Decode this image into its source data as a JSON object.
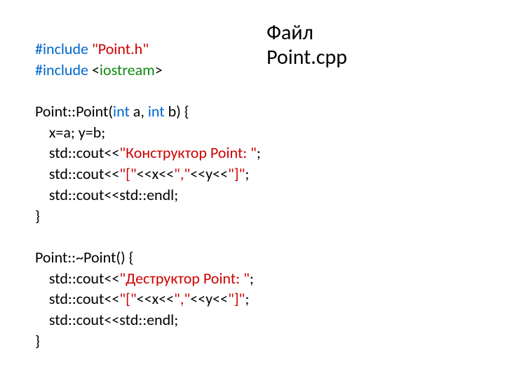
{
  "title": {
    "line1": "Файл",
    "line2": "Point.cpp"
  },
  "code": {
    "include_kw1": "#include",
    "include_hdr": " \"Point.h\"",
    "include_kw2": "#include",
    "include_io_open": " <",
    "include_io_name": "iostream",
    "include_io_close": ">",
    "ctor_sig_a": "Point::Point(",
    "int1": "int",
    "ctor_sig_b": " a, ",
    "int2": "int",
    "ctor_sig_c": " b) {",
    "assign": "    x=a; y=b;",
    "ctor_cout_pre": "    std::cout<<",
    "ctor_msg": "\"Конструктор Point: \"",
    "semicolon1": ";",
    "brkt_line_pre": "    std::cout<<",
    "brkt_open": "\"[\"",
    "brkt_mid1": "<<x<<",
    "brkt_comma": "\",\"",
    "brkt_mid2": "<<y<<",
    "brkt_close": "\"]\"",
    "semicolon2": ";",
    "endl_line": "    std::cout<<std::endl;",
    "close_brace1": "}",
    "dtor_sig": "Point::~Point() {",
    "dtor_cout_pre": "    std::cout<<",
    "dtor_msg": "\"Деструктор Point: \"",
    "semicolon3": ";",
    "brkt2_line_pre": "    std::cout<<",
    "brkt2_open": "\"[\"",
    "brkt2_mid1": "<<x<<",
    "brkt2_comma": "\",\"",
    "brkt2_mid2": "<<y<<",
    "brkt2_close": "\"]\"",
    "semicolon4": ";",
    "endl_line2": "    std::cout<<std::endl;",
    "close_brace2": "}"
  }
}
